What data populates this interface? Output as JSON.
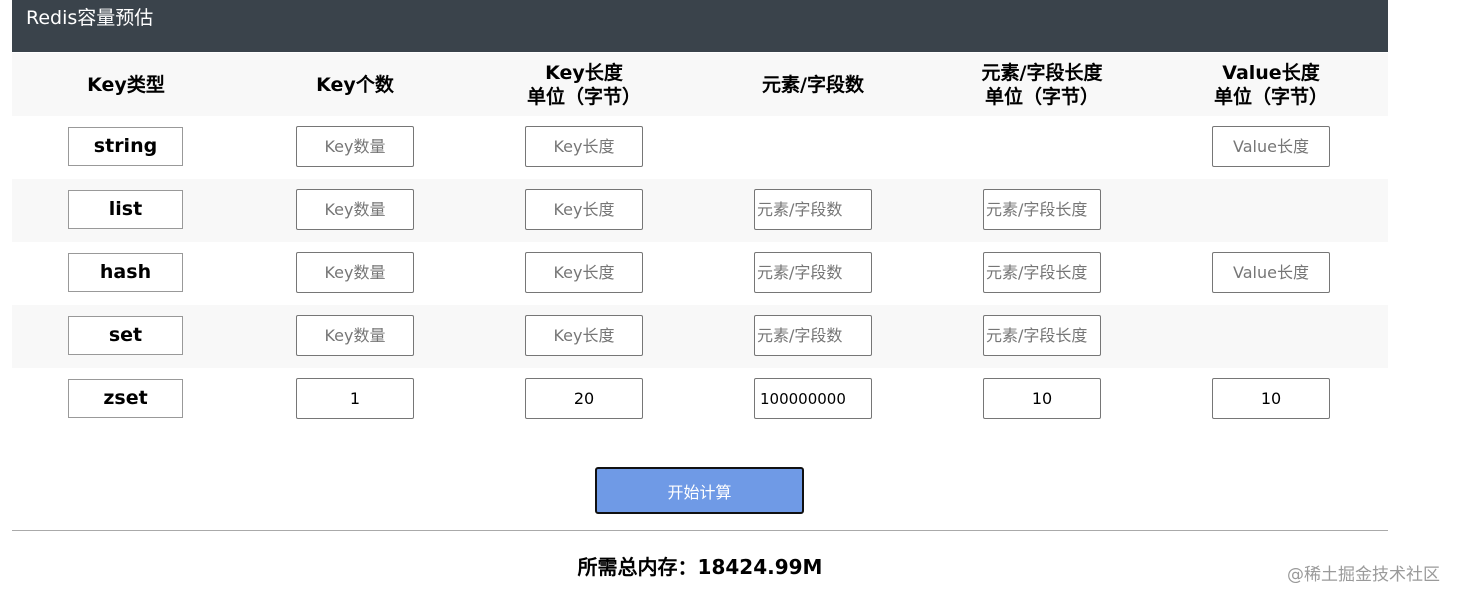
{
  "header": {
    "title": "Redis容量预估"
  },
  "columns": {
    "key_type": "Key类型",
    "key_count": "Key个数",
    "key_length_line1": "Key长度",
    "key_length_line2": "单位（字节）",
    "element_count": "元素/字段数",
    "element_length_line1": "元素/字段长度",
    "element_length_line2": "单位（字节）",
    "value_length_line1": "Value长度",
    "value_length_line2": "单位（字节）"
  },
  "placeholders": {
    "key_count": "Key数量",
    "key_length": "Key长度",
    "element_count": "元素/字段数",
    "element_length": "元素/字段长度",
    "value_length": "Value长度"
  },
  "rows": {
    "string": {
      "type": "string",
      "key_count": "",
      "key_length": "",
      "value_length": ""
    },
    "list": {
      "type": "list",
      "key_count": "",
      "key_length": "",
      "element_count": "",
      "element_length": ""
    },
    "hash": {
      "type": "hash",
      "key_count": "",
      "key_length": "",
      "element_count": "",
      "element_length": "",
      "value_length": ""
    },
    "set": {
      "type": "set",
      "key_count": "",
      "key_length": "",
      "element_count": "",
      "element_length": ""
    },
    "zset": {
      "type": "zset",
      "key_count": "1",
      "key_length": "20",
      "element_count": "100000000",
      "element_length": "10",
      "value_length": "10"
    }
  },
  "actions": {
    "calculate_label": "开始计算"
  },
  "result": {
    "text": "所需总内存：18424.99M"
  },
  "watermark": "@稀土掘金技术社区",
  "colors": {
    "header_bg": "#3a434b",
    "button_bg": "#6f9ae6",
    "band_bg": "#f8f8f8"
  }
}
